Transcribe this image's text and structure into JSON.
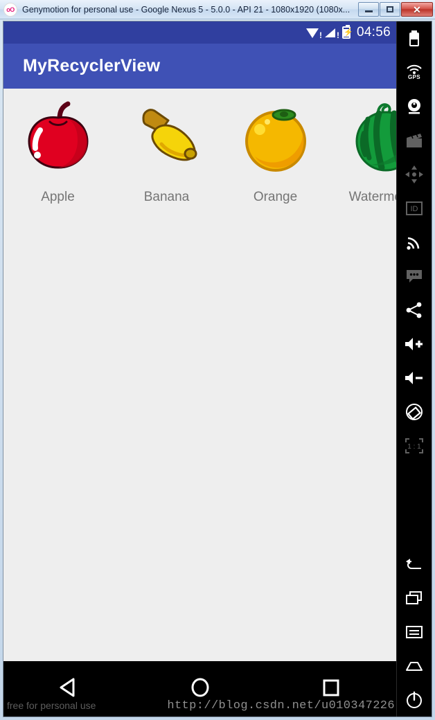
{
  "window": {
    "title": "Genymotion for personal use - Google Nexus 5 - 5.0.0 - API 21 - 1080x1920 (1080x...",
    "logo_text": "oO",
    "controls": {
      "minimize": "minimize",
      "maximize": "restore",
      "close": "✕"
    }
  },
  "status_bar": {
    "time": "04:56",
    "wifi_alert": "!",
    "signal_alert": "!",
    "battery_bolt": "⚡",
    "background_color": "#303F9F"
  },
  "app_bar": {
    "title": "MyRecyclerView",
    "background_color": "#3F51B5"
  },
  "content": {
    "background_color": "#EEEEEE",
    "items": [
      {
        "label": "Apple",
        "icon": "apple-icon",
        "color": "#E00020"
      },
      {
        "label": "Banana",
        "icon": "banana-icon",
        "color": "#F5D40A"
      },
      {
        "label": "Orange",
        "icon": "orange-icon",
        "color": "#F5B800"
      },
      {
        "label": "Watermelon",
        "icon": "watermelon-icon",
        "color": "#139B3B"
      }
    ]
  },
  "nav_bar": {
    "back": "back",
    "home": "home",
    "recents": "recents"
  },
  "watermarks": {
    "free": "free for personal use",
    "url": "http://blog.csdn.net/u010347226"
  },
  "toolbar": {
    "items": [
      {
        "name": "battery-icon",
        "label": "Battery"
      },
      {
        "name": "gps-icon",
        "label": "GPS"
      },
      {
        "name": "webcam-icon",
        "label": "Camera"
      },
      {
        "name": "video-clapper-icon",
        "label": "Video"
      },
      {
        "name": "dpad-icon",
        "label": "D-Pad"
      },
      {
        "name": "identifiers-icon",
        "label": "ID"
      },
      {
        "name": "network-icon",
        "label": "Network"
      },
      {
        "name": "sms-icon",
        "label": "SMS"
      },
      {
        "name": "share-icon",
        "label": "Share"
      },
      {
        "name": "volume-up-icon",
        "label": "Volume Up"
      },
      {
        "name": "volume-down-icon",
        "label": "Volume Down"
      },
      {
        "name": "rotate-screen-icon",
        "label": "Rotate"
      },
      {
        "name": "scale-one-to-one-icon",
        "label": "1 : 1"
      },
      {
        "name": "back-icon",
        "label": "Back"
      },
      {
        "name": "recents-icon",
        "label": "Recents"
      },
      {
        "name": "menu-icon",
        "label": "Menu"
      },
      {
        "name": "home-icon",
        "label": "Home"
      },
      {
        "name": "power-icon",
        "label": "Power"
      }
    ],
    "ratio_label": "1 : 1"
  }
}
